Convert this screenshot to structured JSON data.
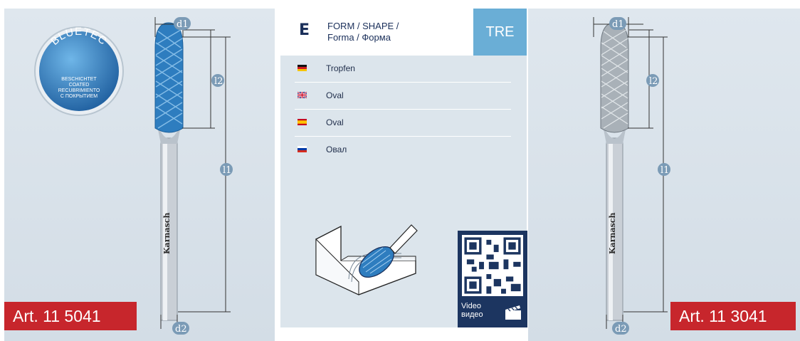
{
  "shape": {
    "letter": "E",
    "label_line1": "FORM / SHAPE /",
    "label_line2_bold": "Forma /",
    "label_line2": " Форма",
    "code": "TRE"
  },
  "languages": [
    {
      "flag": "de",
      "name": "Tropfen"
    },
    {
      "flag": "gb",
      "name": "Oval"
    },
    {
      "flag": "es",
      "name": "Oval"
    },
    {
      "flag": "ru",
      "name": "Овал"
    }
  ],
  "badge": {
    "brand": "BLUETEC",
    "lines": [
      "BESCHICHTET",
      "COATED",
      "RECUBRIMIENTO",
      "С ПОКРЫТИЕМ"
    ]
  },
  "dimensions": {
    "d1": "d1",
    "d2": "d2",
    "l1": "l1",
    "l2": "l2"
  },
  "tool_brand": "Karnasch",
  "video": {
    "line1": "Video",
    "line2": "видео"
  },
  "articles": {
    "left": "Art. 11 5041",
    "right": "Art. 11 3041"
  },
  "colors": {
    "accent_red": "#c7262c",
    "tre_blue": "#6aaed6",
    "navy": "#1c3560",
    "coating_blue": "#2f7fc0"
  }
}
